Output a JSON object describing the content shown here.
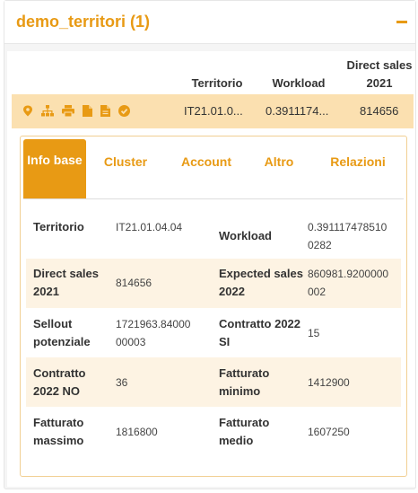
{
  "panel": {
    "title": "demo_territori (1)"
  },
  "table": {
    "headers": {
      "territorio": "Territorio",
      "workload": "Workload",
      "direct_sales": "Direct sales 2021"
    },
    "row": {
      "icons": [
        "map-pin-icon",
        "sitemap-icon",
        "print-icon",
        "document-icon",
        "pdf-icon",
        "check-circle-icon"
      ],
      "territorio": "IT21.01.0...",
      "workload": "0.3911174...",
      "direct_sales": "814656"
    }
  },
  "tabs": [
    "Info base",
    "Cluster",
    "Account",
    "Altro",
    "Relazioni"
  ],
  "fields": [
    {
      "l1": "Territorio",
      "v1": "IT21.01.04.04",
      "l2": "Workload",
      "v2": "0.391117478510 0282"
    },
    {
      "l1": "Direct sales 2021",
      "v1": "814656",
      "l2": "Expected sales 2022",
      "v2": "860981.9200000 002"
    },
    {
      "l1": "Sellout potenziale",
      "v1": "1721963.84000 00003",
      "l2": "Contratto 2022 SI",
      "v2": "15"
    },
    {
      "l1": "Contratto 2022 NO",
      "v1": "36",
      "l2": "Fatturato minimo",
      "v2": "1412900"
    },
    {
      "l1": "Fatturato massimo",
      "v1": "1816800",
      "l2": "Fatturato medio",
      "v2": "1607250"
    }
  ],
  "colors": {
    "accent": "#e89a14",
    "row_highlight": "#fbe0b0",
    "stripe": "#fdf3e3"
  }
}
